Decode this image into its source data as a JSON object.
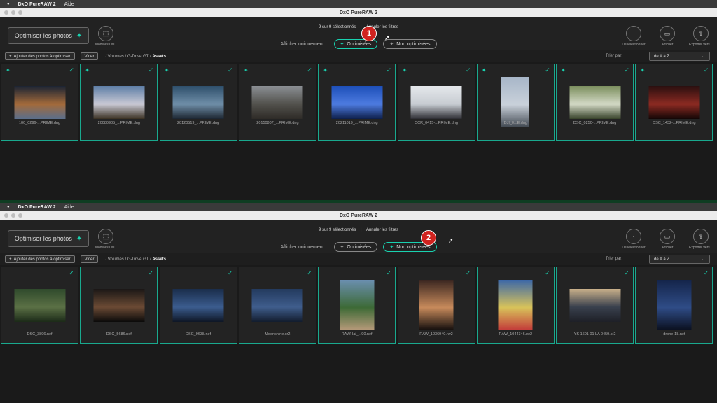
{
  "menu": {
    "app": "DxO PureRAW 2",
    "help": "Aide"
  },
  "window_title": "DxO PureRAW 2",
  "toolbar": {
    "optimize_label": "Optimiser les photos",
    "modules_label": "Modules DxO",
    "deselect_label": "Désélectionner",
    "show_label": "Afficher",
    "export_label": "Exporter vers..."
  },
  "status": {
    "selected": "9 sur 9 sélectionnés",
    "cancel_filters": "Annuler les filtres"
  },
  "filter": {
    "label": "Afficher uniquement :",
    "optimized": "Optimisées",
    "not_optimized": "Non optimisées"
  },
  "pathbar": {
    "add_label": "Ajouter des photos à optimiser",
    "clear_label": "Vider",
    "path_prefix": "/ Volumes / G-Drive GT /",
    "path_current": "Assets",
    "sort_label": "Trier par:",
    "sort_value": "de A à Z"
  },
  "panels": [
    {
      "badge": "1",
      "active_filter": "optimized",
      "files": [
        {
          "name": "100_0296-...PRIME.dng",
          "colors": [
            "#1b2433",
            "#a36a3a",
            "#5a6e8c"
          ],
          "shape": "land"
        },
        {
          "name": "20080905_...PRIME.dng",
          "colors": [
            "#5d7ea6",
            "#c9c9d4",
            "#3a3022"
          ],
          "shape": "land"
        },
        {
          "name": "20120519_...PRIME.dng",
          "colors": [
            "#2e4f6b",
            "#6f8ea8",
            "#1c2631"
          ],
          "shape": "land"
        },
        {
          "name": "20150807_...PRIME.dng",
          "colors": [
            "#8b8f94",
            "#52514c",
            "#2e2b27"
          ],
          "shape": "land"
        },
        {
          "name": "20211019_...PRIME.dng",
          "colors": [
            "#1d4fb8",
            "#4d7be0",
            "#0d1f4a"
          ],
          "shape": "land"
        },
        {
          "name": "CCR_0415-...PRIME.dng",
          "colors": [
            "#e5e8ec",
            "#c7ccd2",
            "#2d2d33"
          ],
          "shape": "land"
        },
        {
          "name": "DJI_0...E.dng",
          "colors": [
            "#a7b6c8",
            "#c9d1da",
            "#404750"
          ],
          "shape": "portrait"
        },
        {
          "name": "DSC_0250-...PRIME.dng",
          "colors": [
            "#7b8e5d",
            "#d3d9c5",
            "#37422a"
          ],
          "shape": "land"
        },
        {
          "name": "DSC_1432-...PRIME.dng",
          "colors": [
            "#2a0f0f",
            "#8c2a22",
            "#130606"
          ],
          "shape": "land"
        }
      ]
    },
    {
      "badge": "2",
      "active_filter": "not_optimized",
      "files": [
        {
          "name": "DSC_3896.nef",
          "colors": [
            "#2f4a2c",
            "#5b7045",
            "#1b2a18"
          ],
          "shape": "land"
        },
        {
          "name": "DSC_5686.nef",
          "colors": [
            "#1b1716",
            "#6b4a34",
            "#0b0a0a"
          ],
          "shape": "land"
        },
        {
          "name": "DSC_9638.nef",
          "colors": [
            "#1a2d4b",
            "#3b5c8e",
            "#0e1626"
          ],
          "shape": "land"
        },
        {
          "name": "Moonshine.cr2",
          "colors": [
            "#233a5e",
            "#3f5d8c",
            "#121c2e"
          ],
          "shape": "land"
        },
        {
          "name": "RAWHai_...90.nef",
          "colors": [
            "#6b8fb0",
            "#3d6a36",
            "#b79a7a"
          ],
          "shape": "portrait"
        },
        {
          "name": "RAW_1036940.rw2",
          "colors": [
            "#3a2620",
            "#c78a5b",
            "#120d0c"
          ],
          "shape": "portrait"
        },
        {
          "name": "RAW_1044346.rw2",
          "colors": [
            "#3b67a8",
            "#d8c35a",
            "#c33a3a"
          ],
          "shape": "portrait"
        },
        {
          "name": "YS 1601 01 LA 0459.cr2",
          "colors": [
            "#c9b08a",
            "#39404d",
            "#1e2027"
          ],
          "shape": "land"
        },
        {
          "name": "drone-18.nef",
          "colors": [
            "#14244a",
            "#2f4c86",
            "#0a0f1e"
          ],
          "shape": "portrait"
        }
      ]
    }
  ]
}
